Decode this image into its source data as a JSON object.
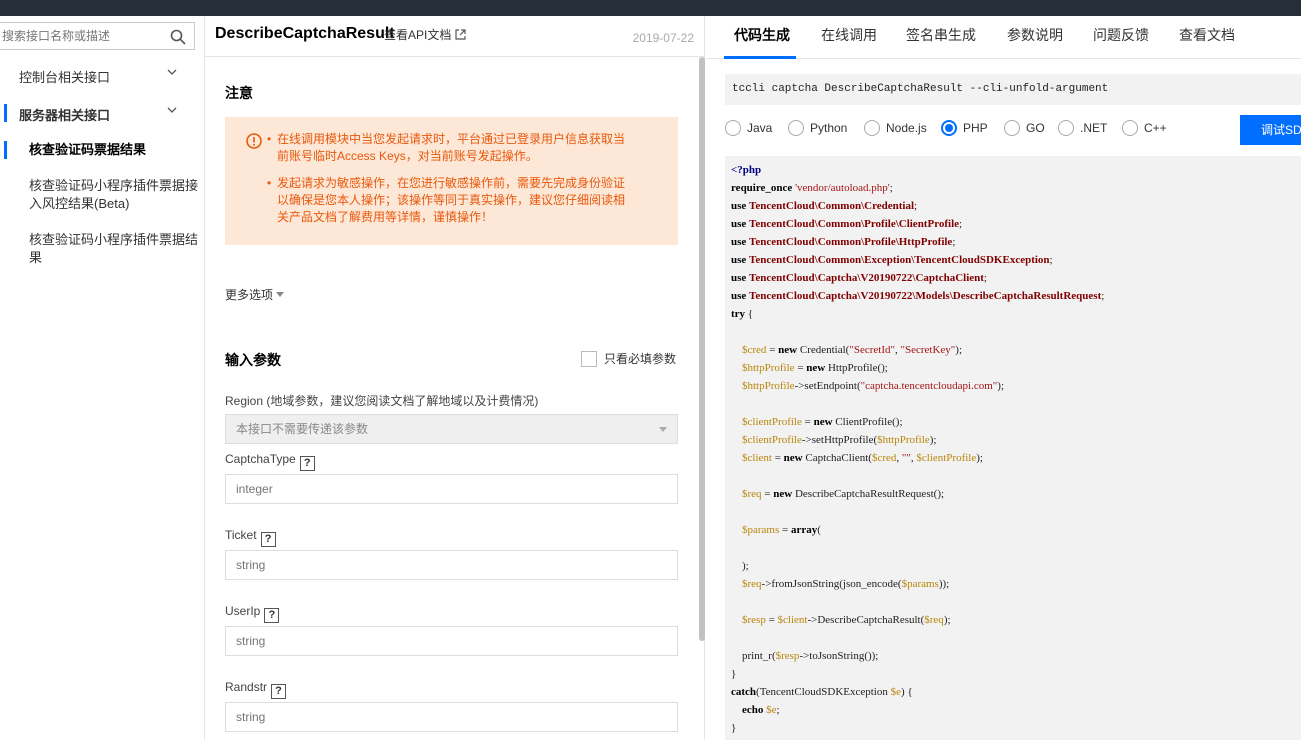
{
  "sidebar": {
    "search": {
      "placeholder": "搜索接口名称或描述"
    },
    "groups": [
      {
        "label": "控制台相关接口"
      },
      {
        "label": "服务器相关接口"
      }
    ],
    "items": [
      {
        "label": "核查验证码票据结果"
      },
      {
        "label": "核查验证码小程序插件票据接入风控结果(Beta)"
      },
      {
        "label": "核查验证码小程序插件票据结果"
      }
    ]
  },
  "header": {
    "api_name": "DescribeCaptchaResult",
    "doc_link": "查看API文档",
    "date": "2019-07-22"
  },
  "notice": {
    "title": "注意",
    "bullets": [
      [
        "在线调用模块中当您发起请求时，平台通过已登录用户信息获取当",
        "前账号临时Access Keys，对当前账号发起操作。"
      ],
      [
        "发起请求为敏感操作，在您进行敏感操作前，需要先完成身份验证",
        "以确保是您本人操作；该操作等同于真实操作，建议您仔细阅读相",
        "关产品文档了解费用等详情，谨慎操作！"
      ]
    ]
  },
  "more_options": "更多选项",
  "params": {
    "title": "输入参数",
    "only_required": "只看必填参数",
    "region": {
      "label": "Region (地域参数，建议您阅读文档了解地域以及计费情况)",
      "value": "本接口不需要传递该参数"
    },
    "fields": [
      {
        "label": "CaptchaType",
        "help": "?",
        "placeholder": "integer"
      },
      {
        "label": "Ticket",
        "help": "?",
        "placeholder": "string"
      },
      {
        "label": "UserIp",
        "help": "?",
        "placeholder": "string"
      },
      {
        "label": "Randstr",
        "help": "?",
        "placeholder": "string"
      }
    ]
  },
  "tabs": [
    {
      "label": "代码生成",
      "active": true
    },
    {
      "label": "在线调用"
    },
    {
      "label": "签名串生成"
    },
    {
      "label": "参数说明"
    },
    {
      "label": "问题反馈"
    },
    {
      "label": "查看文档"
    }
  ],
  "cli": "tccli captcha DescribeCaptchaResult --cli-unfold-argument",
  "languages": {
    "options": [
      "Java",
      "Python",
      "Node.js",
      "PHP",
      "GO",
      ".NET",
      "C++"
    ],
    "selected": "PHP"
  },
  "debug_button": "调试SDK",
  "code_lines": [
    "<?php",
    "require_once 'vendor/autoload.php';",
    "use TencentCloud\\Common\\Credential;",
    "use TencentCloud\\Common\\Profile\\ClientProfile;",
    "use TencentCloud\\Common\\Profile\\HttpProfile;",
    "use TencentCloud\\Common\\Exception\\TencentCloudSDKException;",
    "use TencentCloud\\Captcha\\V20190722\\CaptchaClient;",
    "use TencentCloud\\Captcha\\V20190722\\Models\\DescribeCaptchaResultRequest;",
    "try {",
    "",
    "    $cred = new Credential(\"SecretId\", \"SecretKey\");",
    "    $httpProfile = new HttpProfile();",
    "    $httpProfile->setEndpoint(\"captcha.tencentcloudapi.com\");",
    "",
    "    $clientProfile = new ClientProfile();",
    "    $clientProfile->setHttpProfile($httpProfile);",
    "    $client = new CaptchaClient($cred, \"\", $clientProfile);",
    "",
    "    $req = new DescribeCaptchaResultRequest();",
    "",
    "    $params = array(",
    "",
    "    );",
    "    $req->fromJsonString(json_encode($params));",
    "",
    "    $resp = $client->DescribeCaptchaResult($req);",
    "",
    "    print_r($resp->toJsonString());",
    "}",
    "catch(TencentCloudSDKException $e) {",
    "    echo $e;",
    "}"
  ],
  "colors": {
    "accent": "#006eff",
    "notice_bg": "#fde7d7",
    "notice_text": "#e8590c",
    "topbar": "#262e3a"
  }
}
